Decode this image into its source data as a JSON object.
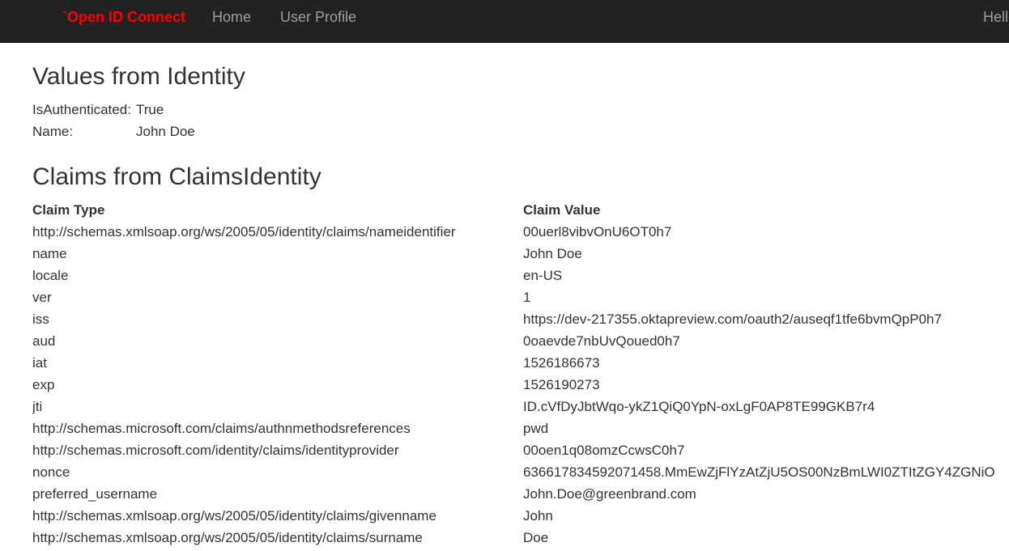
{
  "navbar": {
    "brand": "`Open ID Connect",
    "links": [
      "Home",
      "User Profile"
    ],
    "greeting": "Hello"
  },
  "identity": {
    "heading": "Values from Identity",
    "rows": [
      {
        "key": "IsAuthenticated:",
        "value": "True"
      },
      {
        "key": "Name:",
        "value": "John Doe"
      }
    ]
  },
  "claims": {
    "heading": "Claims from ClaimsIdentity",
    "columns": [
      "Claim Type",
      "Claim Value"
    ],
    "rows": [
      {
        "type": "http://schemas.xmlsoap.org/ws/2005/05/identity/claims/nameidentifier",
        "value": "00uerl8vibvOnU6OT0h7"
      },
      {
        "type": "name",
        "value": "John Doe"
      },
      {
        "type": "locale",
        "value": "en-US"
      },
      {
        "type": "ver",
        "value": "1"
      },
      {
        "type": "iss",
        "value": "https://dev-217355.oktapreview.com/oauth2/auseqf1tfe6bvmQpP0h7"
      },
      {
        "type": "aud",
        "value": "0oaevde7nbUvQoued0h7"
      },
      {
        "type": "iat",
        "value": "1526186673"
      },
      {
        "type": "exp",
        "value": "1526190273"
      },
      {
        "type": "jti",
        "value": "ID.cVfDyJbtWqo-ykZ1QiQ0YpN-oxLgF0AP8TE99GKB7r4"
      },
      {
        "type": "http://schemas.microsoft.com/claims/authnmethodsreferences",
        "value": "pwd"
      },
      {
        "type": "http://schemas.microsoft.com/identity/claims/identityprovider",
        "value": "00oen1q08omzCcwsC0h7"
      },
      {
        "type": "nonce",
        "value": "636617834592071458.MmEwZjFlYzAtZjU5OS00NzBmLWI0ZTItZGY4ZGNiO"
      },
      {
        "type": "preferred_username",
        "value": "John.Doe@greenbrand.com"
      },
      {
        "type": "http://schemas.xmlsoap.org/ws/2005/05/identity/claims/givenname",
        "value": "John"
      },
      {
        "type": "http://schemas.xmlsoap.org/ws/2005/05/identity/claims/surname",
        "value": "Doe"
      }
    ]
  }
}
